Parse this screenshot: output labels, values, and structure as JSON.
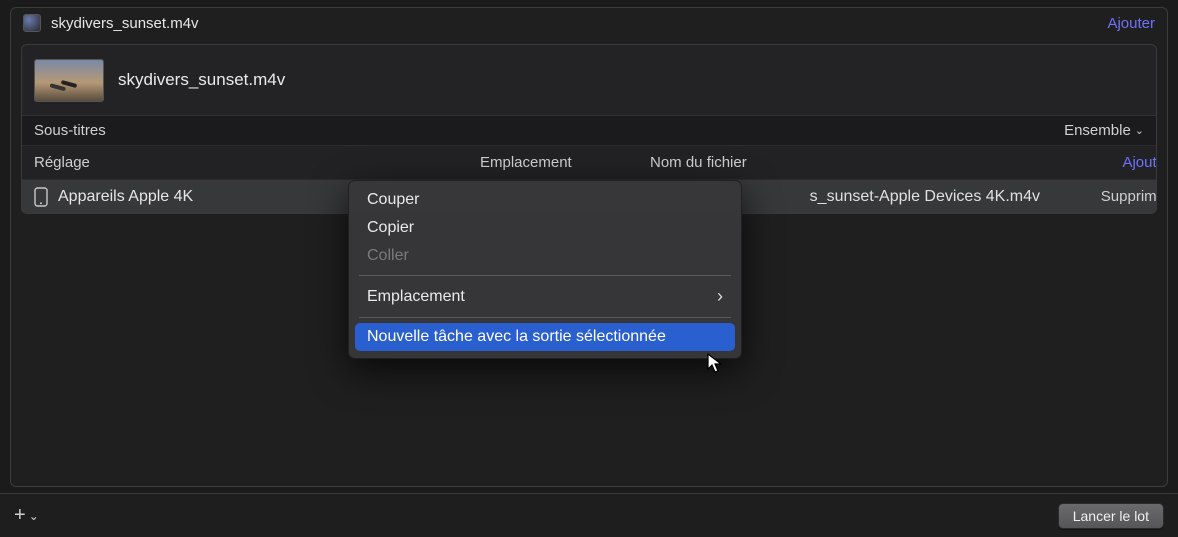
{
  "titlebar": {
    "filename": "skydivers_sunset.m4v",
    "add_label": "Ajouter"
  },
  "job": {
    "name": "skydivers_sunset.m4v"
  },
  "subtitles_row": {
    "label": "Sous-titres",
    "ensemble_label": "Ensemble"
  },
  "columns": {
    "setting": "Réglage",
    "location": "Emplacement",
    "filename": "Nom du fichier",
    "add": "Ajouter"
  },
  "output_row": {
    "setting_name": "Appareils Apple 4K",
    "output_filename": "s_sunset-Apple Devices 4K.m4v",
    "delete_label": "Supprimer"
  },
  "context_menu": {
    "cut": "Couper",
    "copy": "Copier",
    "paste": "Coller",
    "location": "Emplacement",
    "new_task": "Nouvelle tâche avec la sortie sélectionnée"
  },
  "bottombar": {
    "launch": "Lancer le lot"
  }
}
